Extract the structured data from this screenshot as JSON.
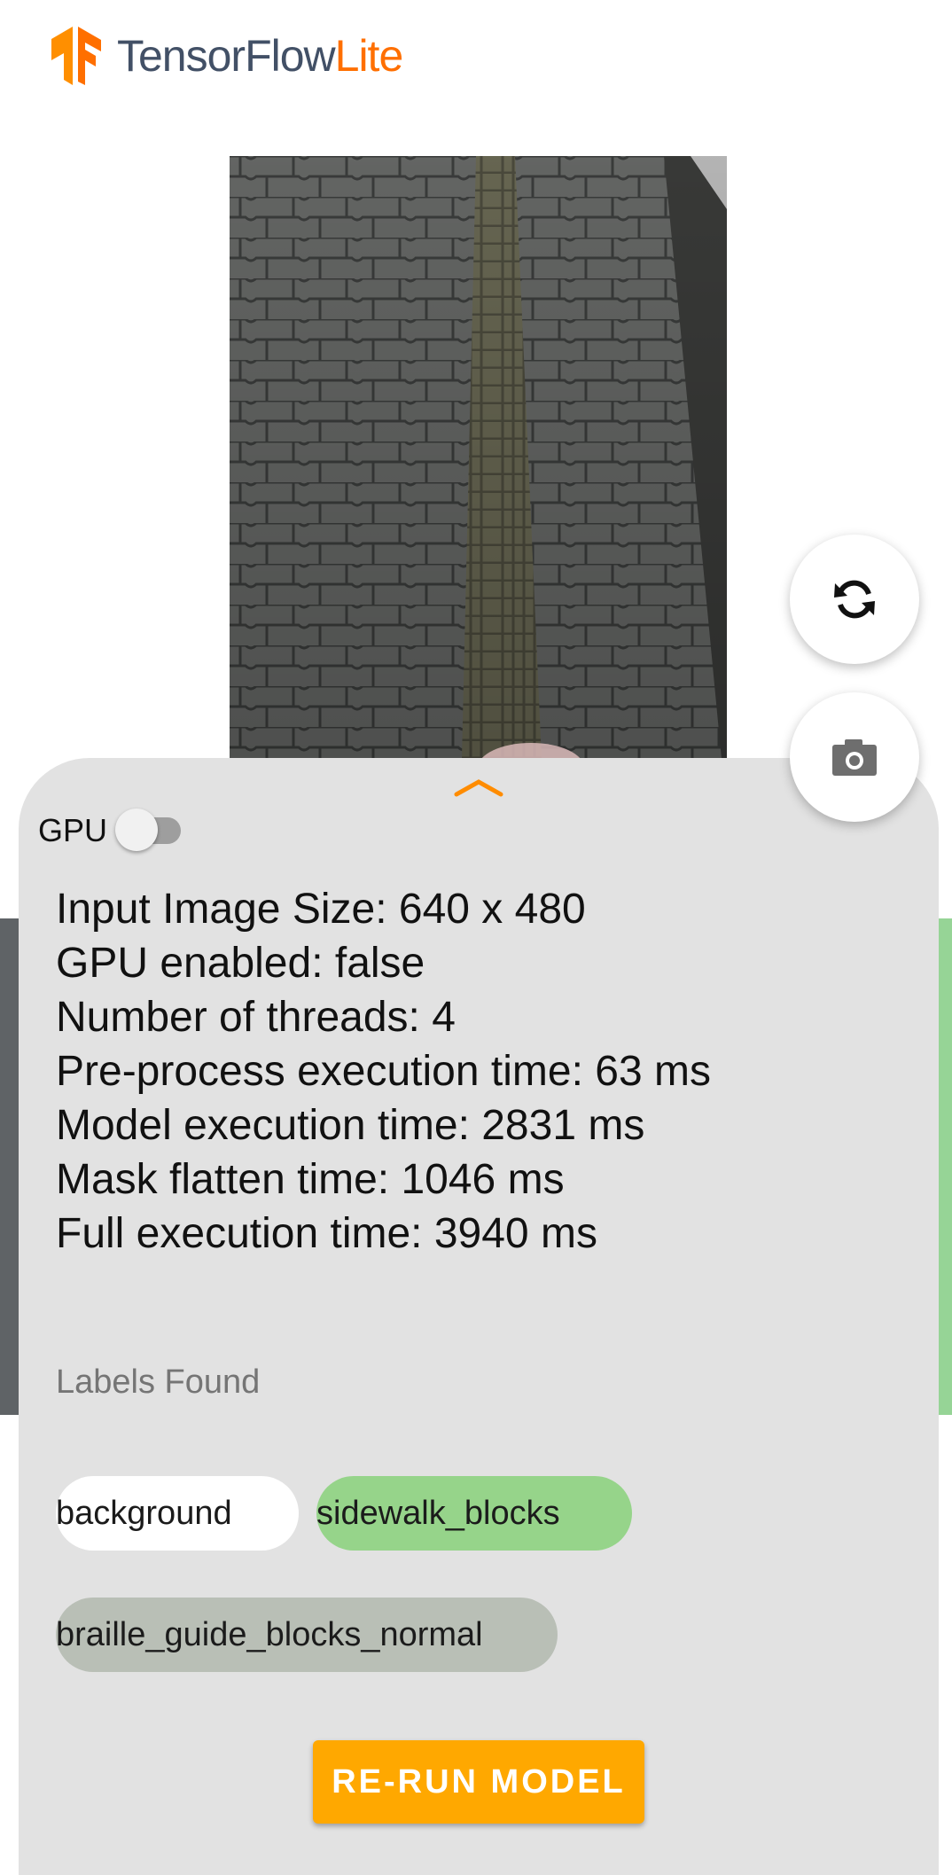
{
  "header": {
    "brand_primary": "TensorFlow",
    "brand_secondary": "Lite",
    "logo_icon": "tensorflow-logo-icon",
    "colors": {
      "primary": "#425066",
      "secondary": "#ff6f00"
    }
  },
  "preview": {
    "icon": "camera-preview-image"
  },
  "buttons": {
    "switch_camera_icon": "sync-arrows-icon",
    "capture_icon": "camera-icon"
  },
  "sheet": {
    "expand_icon": "chevron-up-icon",
    "gpu_label": "GPU",
    "gpu_enabled": false,
    "stats": [
      "Input Image Size: 640 x 480",
      "GPU enabled: false",
      "Number of threads: 4",
      "Pre-process execution time: 63 ms",
      "Model execution time: 2831 ms",
      "Mask flatten time: 1046 ms",
      "Full execution time: 3940 ms"
    ],
    "labels_heading": "Labels Found",
    "labels": [
      {
        "name": "background",
        "color": "#ffffff"
      },
      {
        "name": "sidewalk_blocks",
        "color": "#96d48a"
      },
      {
        "name": "braille_guide_blocks_normal",
        "color": "#b9bfb6"
      }
    ],
    "rerun_label": "RE-RUN MODEL",
    "accent_color": "#ffa800"
  }
}
